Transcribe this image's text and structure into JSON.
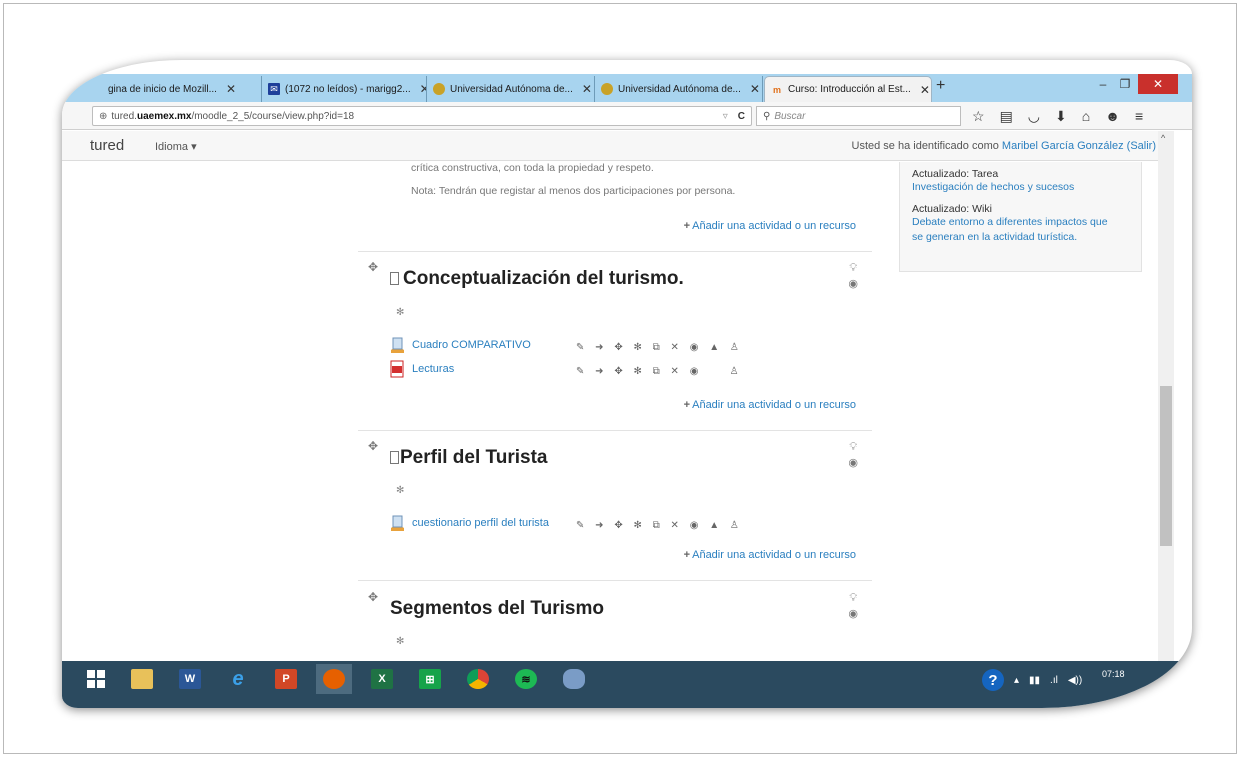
{
  "browser": {
    "tabs": [
      {
        "label": "gina de inicio de Mozill...",
        "close": "✕"
      },
      {
        "label": "(1072 no leídos) - marigg2...",
        "close": "✕"
      },
      {
        "label": "Universidad Autónoma de...",
        "close": "✕"
      },
      {
        "label": "Universidad Autónoma de...",
        "close": "✕"
      },
      {
        "label": "Curso: Introducción al Est...",
        "close": "✕"
      }
    ],
    "new_tab": "+",
    "window_controls": {
      "minimize": "–",
      "restore": "❐",
      "close": "✕"
    },
    "url_prefix": "tured.",
    "url_domain": "uaemex.mx",
    "url_path": "/moodle_2_5/course/view.php?id=18",
    "reload": "C",
    "search_placeholder": "Buscar"
  },
  "header": {
    "brand": "tured",
    "language": "Idioma ▾",
    "login_prefix": "Usted se ha identificado como ",
    "user_name": "Maribel García González",
    "logout": "(Salir)"
  },
  "top_section": {
    "line1": "crítica constructiva, con toda la propiedad y respeto.",
    "line2": "Nota: Tendrán que registar al menos dos participaciones por persona.",
    "add_link": "Añadir una actividad o un recurso"
  },
  "sections": [
    {
      "title": "Conceptualización del turismo.",
      "activities": [
        {
          "label": "Cuadro COMPARATIVO",
          "icon": "assignment-icon"
        },
        {
          "label": "Lecturas",
          "icon": "pdf-icon"
        }
      ],
      "add_link": "Añadir una actividad o un recurso"
    },
    {
      "title": "Perfil del Turista",
      "activities": [
        {
          "label": "cuestionario perfil del turista",
          "icon": "assignment-icon"
        }
      ],
      "add_link": "Añadir una actividad o un recurso"
    },
    {
      "title": "Segmentos del Turismo",
      "activities": [],
      "add_link": ""
    }
  ],
  "edit_icons": "✎ ➜ ✥ ✻ ⧉ ✕ ◉ ▲ ♙",
  "edit_icons_lecturas": "✎ ➜ ✥ ✻ ⧉ ✕ ◉",
  "edit_icons_lecturas_end": "♙",
  "recent_activity": {
    "item1_label": "Actualizado: Tarea",
    "item1_link": "Investigación de hechos y sucesos",
    "item2_label": "Actualizado: Wiki",
    "item2_link_line1": "Debate entorno a diferentes impactos que",
    "item2_link_line2": "se generan en la actividad turística."
  },
  "taskbar": {
    "clock": "07:18",
    "help": "?"
  }
}
